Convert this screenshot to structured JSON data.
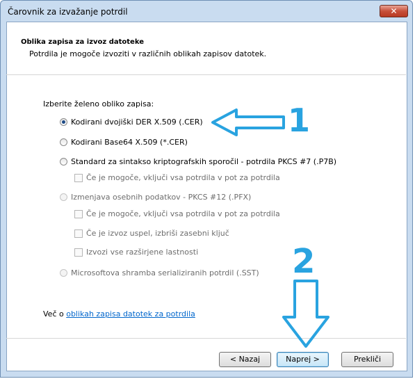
{
  "window": {
    "title": "Čarovnik za izvažanje potrdil",
    "close_label": "✕"
  },
  "header": {
    "title": "Oblika zapisa za izvoz datoteke",
    "subtitle": "Potrdila je mogoče izvoziti v različnih oblikah zapisov datotek."
  },
  "prompt": "Izberite želeno obliko zapisa:",
  "options": {
    "der": {
      "label": "Kodirani dvojiški DER X.509 (.CER)",
      "selected": true
    },
    "base64": {
      "label": "Kodirani Base64 X.509 (*.CER)",
      "selected": false
    },
    "pkcs7": {
      "label": "Standard za sintakso kriptografskih sporočil - potrdila PKCS #7 (.P7B)",
      "selected": false
    },
    "pkcs7_include_all": {
      "label": "Če je mogoče, vključi vsa potrdila v pot za potrdila",
      "checked": false,
      "enabled": false
    },
    "pfx": {
      "label": "Izmenjava osebnih podatkov - PKCS #12 (.PFX)",
      "selected": false,
      "enabled": false
    },
    "pfx_include_all": {
      "label": "Če je mogoče, vključi vsa potrdila v pot za potrdila",
      "checked": false,
      "enabled": false
    },
    "pfx_delete_key": {
      "label": "Če je izvoz uspel, izbriši zasebni ključ",
      "checked": false,
      "enabled": false
    },
    "pfx_export_props": {
      "label": "Izvozi vse razširjene lastnosti",
      "checked": false,
      "enabled": false
    },
    "sst": {
      "label": "Microsoftova shramba serializiranih potrdil (.SST)",
      "selected": false,
      "enabled": false
    }
  },
  "more_info": {
    "prefix": "Več o ",
    "link": "oblikah zapisa datotek za potrdila"
  },
  "buttons": {
    "back": "< Nazaj",
    "next": "Naprej >",
    "cancel": "Prekliči"
  },
  "annotations": {
    "marker_1": "1",
    "marker_2": "2",
    "color": "#29a3e0"
  }
}
